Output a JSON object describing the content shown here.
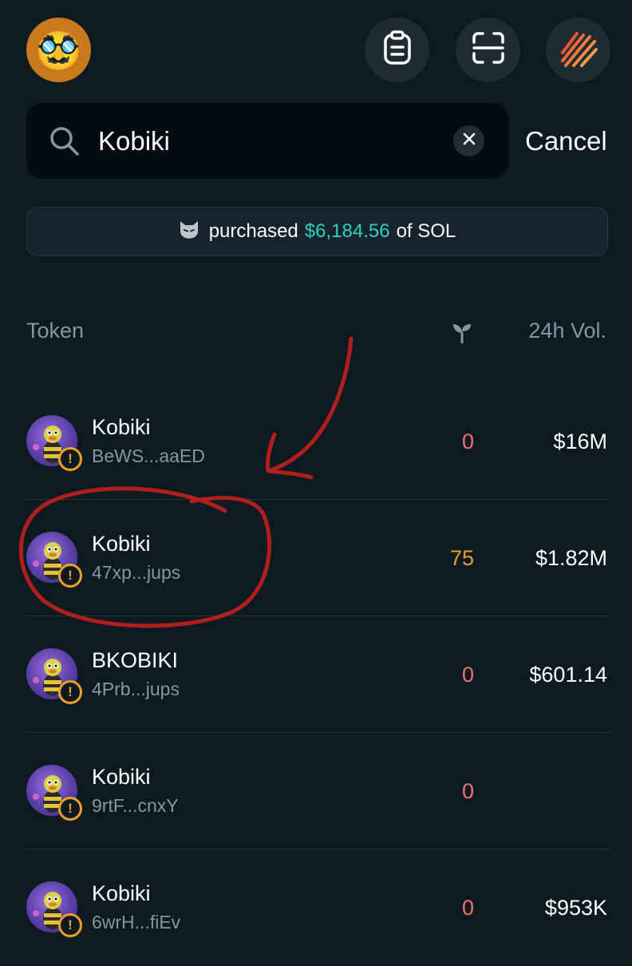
{
  "header": {
    "avatar_emoji": "🥸",
    "clipboard_icon": "clipboard-icon",
    "scan_icon": "scan-icon",
    "brand_icon": "brand-stripes-icon"
  },
  "search": {
    "value": "Kobiki",
    "placeholder": "",
    "cancel_label": "Cancel"
  },
  "banner": {
    "icon": "cat-icon",
    "prefix": "purchased",
    "amount": "$6,184.56",
    "suffix": "of SOL"
  },
  "table": {
    "col_token": "Token",
    "col_vol": "24h Vol.",
    "rows": [
      {
        "name": "Kobiki",
        "address": "BeWS...aaED",
        "count": "0",
        "volume": "$16M"
      },
      {
        "name": "Kobiki",
        "address": "47xp...jups",
        "count": "75",
        "volume": "$1.82M"
      },
      {
        "name": "BKOBIKI",
        "address": "4Prb...jups",
        "count": "0",
        "volume": "$601.14"
      },
      {
        "name": "Kobiki",
        "address": "9rtF...cnxY",
        "count": "0",
        "volume": ""
      },
      {
        "name": "Kobiki",
        "address": "6wrH...fiEv",
        "count": "0",
        "volume": "$953K"
      }
    ]
  },
  "colors": {
    "background": "#0e1a21",
    "accent_amount": "#2fd3bd",
    "count_zero": "#f0716a",
    "count_positive": "#f0a020",
    "annotation": "#b01e1e"
  }
}
